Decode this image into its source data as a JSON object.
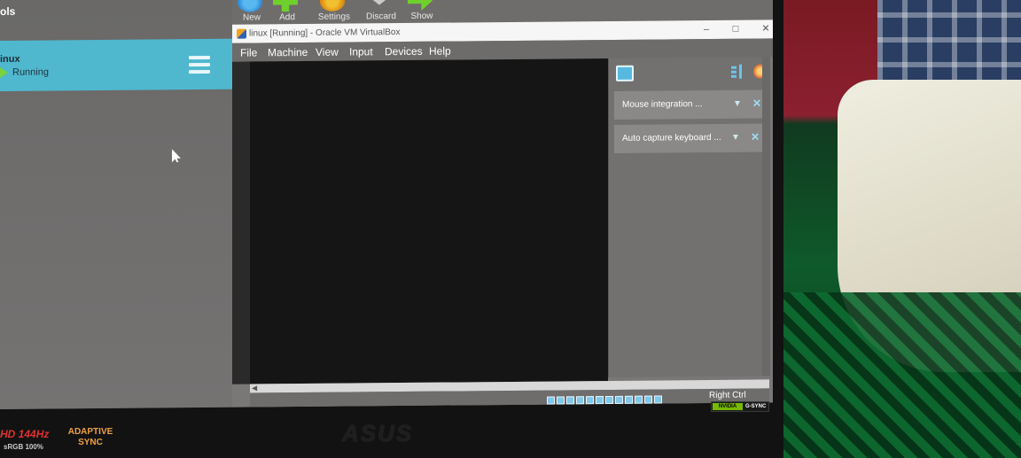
{
  "manager": {
    "tools_label": "ols",
    "toolbar": [
      {
        "label": "New",
        "icon": "new-icon"
      },
      {
        "label": "Add",
        "icon": "add-icon"
      },
      {
        "label": "Settings",
        "icon": "settings-icon"
      },
      {
        "label": "Discard",
        "icon": "discard-icon"
      },
      {
        "label": "Show",
        "icon": "show-icon"
      }
    ],
    "vm": {
      "name": "inux",
      "state": "Running"
    }
  },
  "vm_window": {
    "title": "linux [Running] - Oracle VM VirtualBox",
    "controls": {
      "minimize": "–",
      "maximize": "□",
      "close": "✕"
    },
    "menu": [
      "File",
      "Machine",
      "View",
      "Input",
      "Devices",
      "Help"
    ],
    "notifications": [
      {
        "text": "Mouse integration ..."
      },
      {
        "text": "Auto capture keyboard ..."
      }
    ],
    "host_key": "Right Ctrl"
  },
  "monitor": {
    "hd_label": "HD 144Hz",
    "srgb_label": "sRGB 100%",
    "adaptive_sync": "ADAPTIVE SYNC",
    "brand": "ASUS",
    "nvidia_label": "NVIDIA",
    "gsync_label": "G-SYNC"
  },
  "colors": {
    "vm_selected": "#4fb8cf",
    "running_green": "#7ad23c",
    "guest_screen": "#151515"
  }
}
